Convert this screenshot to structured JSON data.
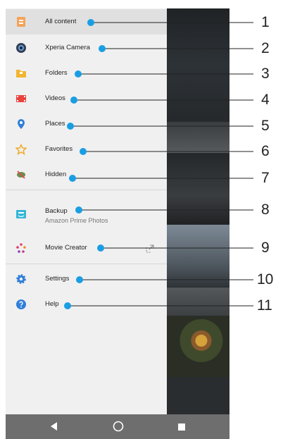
{
  "menu": {
    "items": [
      {
        "label": "All content",
        "selected": true,
        "icon": "all-content-icon"
      },
      {
        "label": "Xperia Camera",
        "icon": "camera-icon"
      },
      {
        "label": "Folders",
        "icon": "folder-icon"
      },
      {
        "label": "Videos",
        "icon": "video-icon"
      },
      {
        "label": "Places",
        "icon": "location-pin-icon"
      },
      {
        "label": "Favorites",
        "icon": "star-icon"
      },
      {
        "label": "Hidden",
        "icon": "hidden-icon"
      },
      {
        "label": "Backup",
        "sublabel": "Amazon Prime Photos",
        "icon": "amazon-photos-icon"
      },
      {
        "label": "Movie Creator",
        "icon": "movie-creator-icon",
        "trailing_icon": "open-external-icon"
      },
      {
        "label": "Settings",
        "icon": "gear-icon"
      },
      {
        "label": "Help",
        "icon": "help-icon"
      }
    ]
  },
  "callouts": [
    "1",
    "2",
    "3",
    "4",
    "5",
    "6",
    "7",
    "8",
    "9",
    "10",
    "11"
  ],
  "navbar": {
    "buttons": [
      "back-icon",
      "home-icon",
      "recents-icon"
    ]
  },
  "colors": {
    "accent": "#1a9ee3",
    "drawer_bg": "#f0f0f0",
    "navbar_bg": "#6e6e6e"
  }
}
